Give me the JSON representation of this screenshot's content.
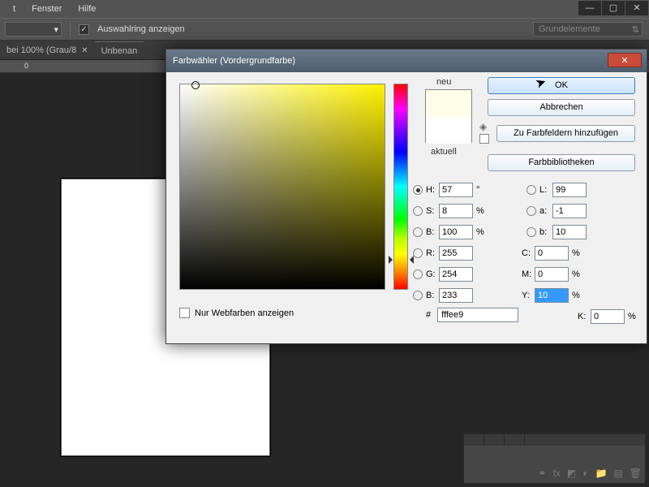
{
  "menubar": {
    "items": [
      "t",
      "Fenster",
      "Hilfe"
    ]
  },
  "optbar": {
    "checkbox_label": "Auswahlring anzeigen",
    "preset_label": "Grundelemente"
  },
  "tabs": [
    {
      "label": "bei 100% (Grau/8",
      "active": false
    },
    {
      "label": "Unbenan",
      "active": true
    }
  ],
  "ruler": {
    "ticks": [
      "0"
    ]
  },
  "dialog": {
    "title": "Farbwähler (Vordergrundfarbe)",
    "labels": {
      "neu": "neu",
      "aktuell": "aktuell"
    },
    "buttons": {
      "ok": "OK",
      "cancel": "Abbrechen",
      "add_swatch": "Zu Farbfeldern hinzufügen",
      "libraries": "Farbbibliotheken"
    },
    "values": {
      "H": "57",
      "H_unit": "°",
      "S": "8",
      "S_unit": "%",
      "Bv": "100",
      "Bv_unit": "%",
      "R": "255",
      "G": "254",
      "Bc": "233",
      "L": "99",
      "a": "-1",
      "b": "10",
      "C": "0",
      "C_unit": "%",
      "M": "0",
      "M_unit": "%",
      "Y": "10",
      "Y_unit": "%",
      "K": "0",
      "K_unit": "%",
      "hex": "fffee9"
    },
    "field_labels": {
      "H": "H:",
      "S": "S:",
      "Bv": "B:",
      "R": "R:",
      "G": "G:",
      "Bc": "B:",
      "L": "L:",
      "a": "a:",
      "b": "b:",
      "C": "C:",
      "M": "M:",
      "Y": "Y:",
      "K": "K:",
      "hash": "#"
    },
    "webonly_label": "Nur Webfarben anzeigen"
  }
}
